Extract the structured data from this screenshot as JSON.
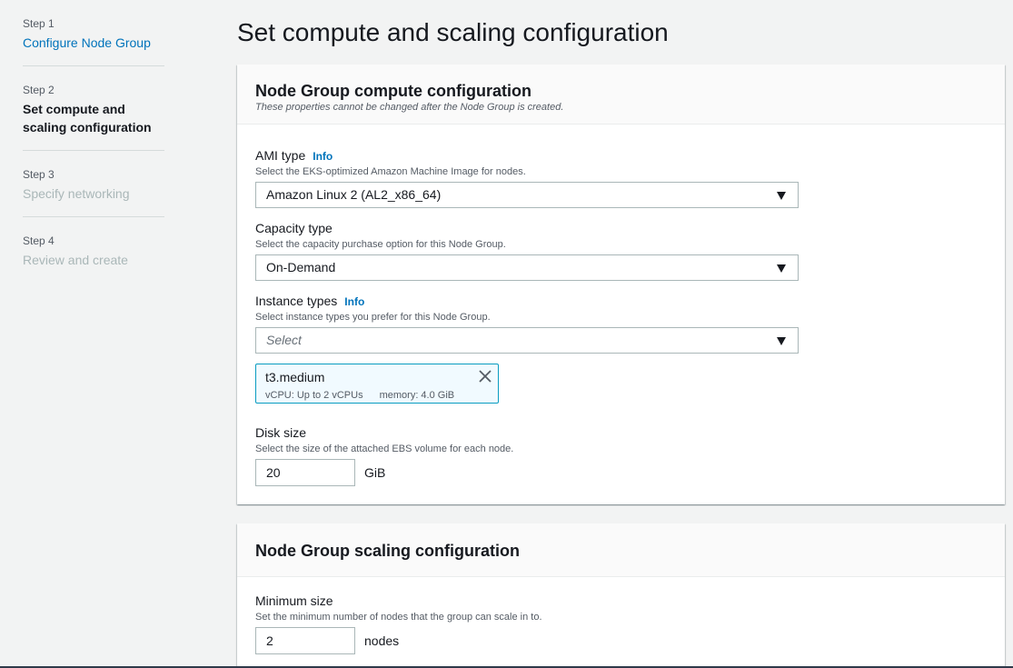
{
  "wizard": {
    "steps": [
      {
        "number": "Step 1",
        "label": "Configure Node Group"
      },
      {
        "number": "Step 2",
        "label": "Set compute and scaling configuration"
      },
      {
        "number": "Step 3",
        "label": "Specify networking"
      },
      {
        "number": "Step 4",
        "label": "Review and create"
      }
    ]
  },
  "page": {
    "title": "Set compute and scaling configuration"
  },
  "compute": {
    "title": "Node Group compute configuration",
    "description": "These properties cannot be changed after the Node Group is created.",
    "ami": {
      "label": "AMI type",
      "info": "Info",
      "description": "Select the EKS-optimized Amazon Machine Image for nodes.",
      "value": "Amazon Linux 2 (AL2_x86_64)"
    },
    "capacity": {
      "label": "Capacity type",
      "description": "Select the capacity purchase option for this Node Group.",
      "value": "On-Demand"
    },
    "instance_types": {
      "label": "Instance types",
      "info": "Info",
      "description": "Select instance types you prefer for this Node Group.",
      "placeholder": "Select",
      "selected": {
        "name": "t3.medium",
        "vcpu": "vCPU: Up to 2 vCPUs",
        "memory": "memory: 4.0 GiB"
      }
    },
    "disk": {
      "label": "Disk size",
      "description": "Select the size of the attached EBS volume for each node.",
      "value": "20",
      "unit": "GiB"
    }
  },
  "scaling": {
    "title": "Node Group scaling configuration",
    "min": {
      "label": "Minimum size",
      "description": "Set the minimum number of nodes that the group can scale in to.",
      "value": "2",
      "unit": "nodes"
    }
  }
}
